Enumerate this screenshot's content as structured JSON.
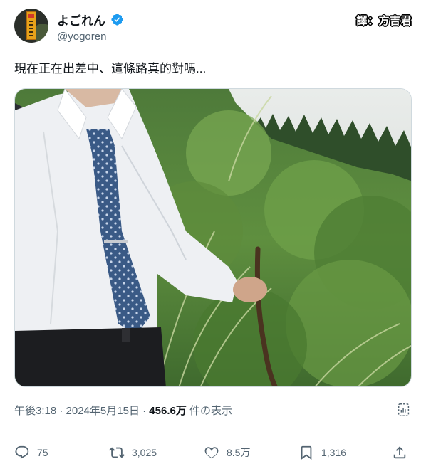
{
  "author": {
    "display_name": "よごれん",
    "handle": "@yogoren",
    "verified": true
  },
  "translator_watermark": "譯：方吉君",
  "tweet": {
    "text": "現在正在出差中、這條路真的對嗎..."
  },
  "meta": {
    "time": "午後3:18",
    "separator1": " · ",
    "date": "2024年5月15日",
    "separator2": " · ",
    "views": "456.6万",
    "views_suffix": " 件の表示"
  },
  "actions": {
    "replies": "75",
    "reposts": "3,025",
    "likes": "8.5万",
    "bookmarks": "1,316"
  },
  "colors": {
    "accent": "#1d9bf0",
    "secondary_text": "#536471",
    "primary_text": "#0f1419"
  },
  "icons": [
    "verified-badge-icon",
    "analytics-icon",
    "reply-icon",
    "repost-icon",
    "like-icon",
    "bookmark-icon",
    "share-icon"
  ]
}
